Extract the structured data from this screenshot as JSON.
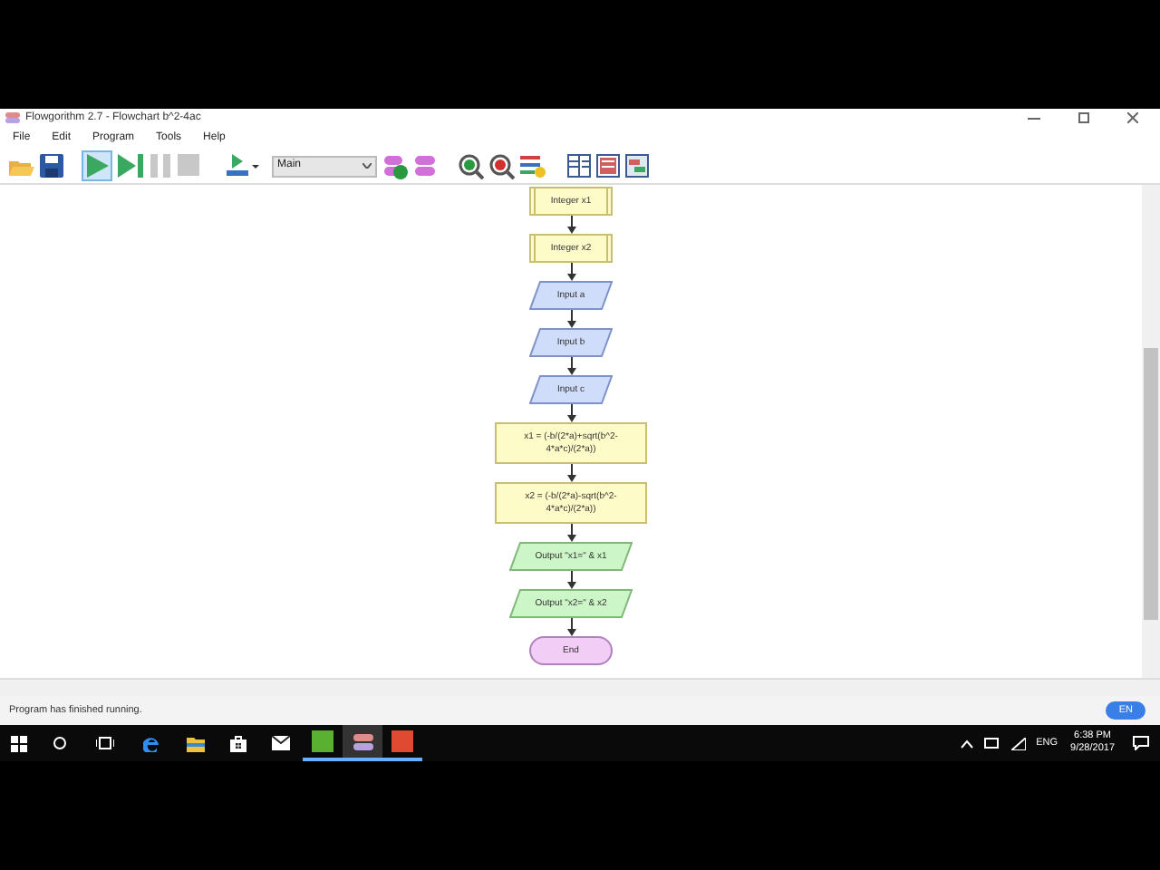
{
  "window": {
    "title": "Flowgorithm 2.7 - Flowchart b^2-4ac"
  },
  "menu": [
    "File",
    "Edit",
    "Program",
    "Tools",
    "Help"
  ],
  "toolbar": {
    "function_select": "Main",
    "run_selected": true
  },
  "flowchart": [
    {
      "kind": "declare",
      "text": "Integer x1"
    },
    {
      "kind": "declare",
      "text": "Integer x2"
    },
    {
      "kind": "input",
      "text": "Input a"
    },
    {
      "kind": "input",
      "text": "Input b"
    },
    {
      "kind": "input",
      "text": "Input c"
    },
    {
      "kind": "assign",
      "text": "x1 = (-b/(2*a)+sqrt(b^2-4*a*c)/(2*a))"
    },
    {
      "kind": "assign",
      "text": "x2 = (-b/(2*a)-sqrt(b^2-4*a*c)/(2*a))"
    },
    {
      "kind": "output",
      "text": "Output \"x1=\" & x1"
    },
    {
      "kind": "output",
      "text": "Output \"x2=\" & x2"
    },
    {
      "kind": "end",
      "text": "End"
    }
  ],
  "status_bar": {
    "message": "Program has finished running.",
    "language": "EN"
  },
  "taskbar": {
    "language": "ENG",
    "time": "6:38 PM",
    "date": "9/28/2017"
  }
}
